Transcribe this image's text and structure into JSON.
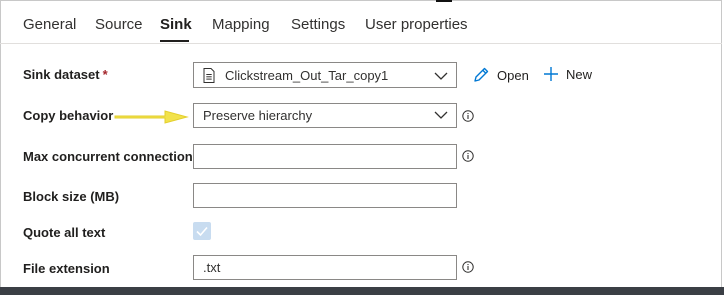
{
  "tabs": [
    {
      "label": "General"
    },
    {
      "label": "Source"
    },
    {
      "label": "Sink"
    },
    {
      "label": "Mapping"
    },
    {
      "label": "Settings"
    },
    {
      "label": "User properties"
    }
  ],
  "sink_dataset": {
    "label": "Sink dataset",
    "required_marker": "*",
    "value": "Clickstream_Out_Tar_copy1"
  },
  "actions": {
    "open_label": "Open",
    "new_label": "New"
  },
  "copy_behavior": {
    "label": "Copy behavior",
    "value": "Preserve hierarchy"
  },
  "max_concurrent": {
    "label": "Max concurrent connections",
    "value": ""
  },
  "block_size": {
    "label": "Block size (MB)",
    "value": ""
  },
  "quote_all_text": {
    "label": "Quote all text",
    "checked": true
  },
  "file_extension": {
    "label": "File extension",
    "value": ".txt"
  },
  "colors": {
    "accent": "#0078d4",
    "arrow": "#f2e24b",
    "checkbox_disabled": "#c8dcf0"
  }
}
